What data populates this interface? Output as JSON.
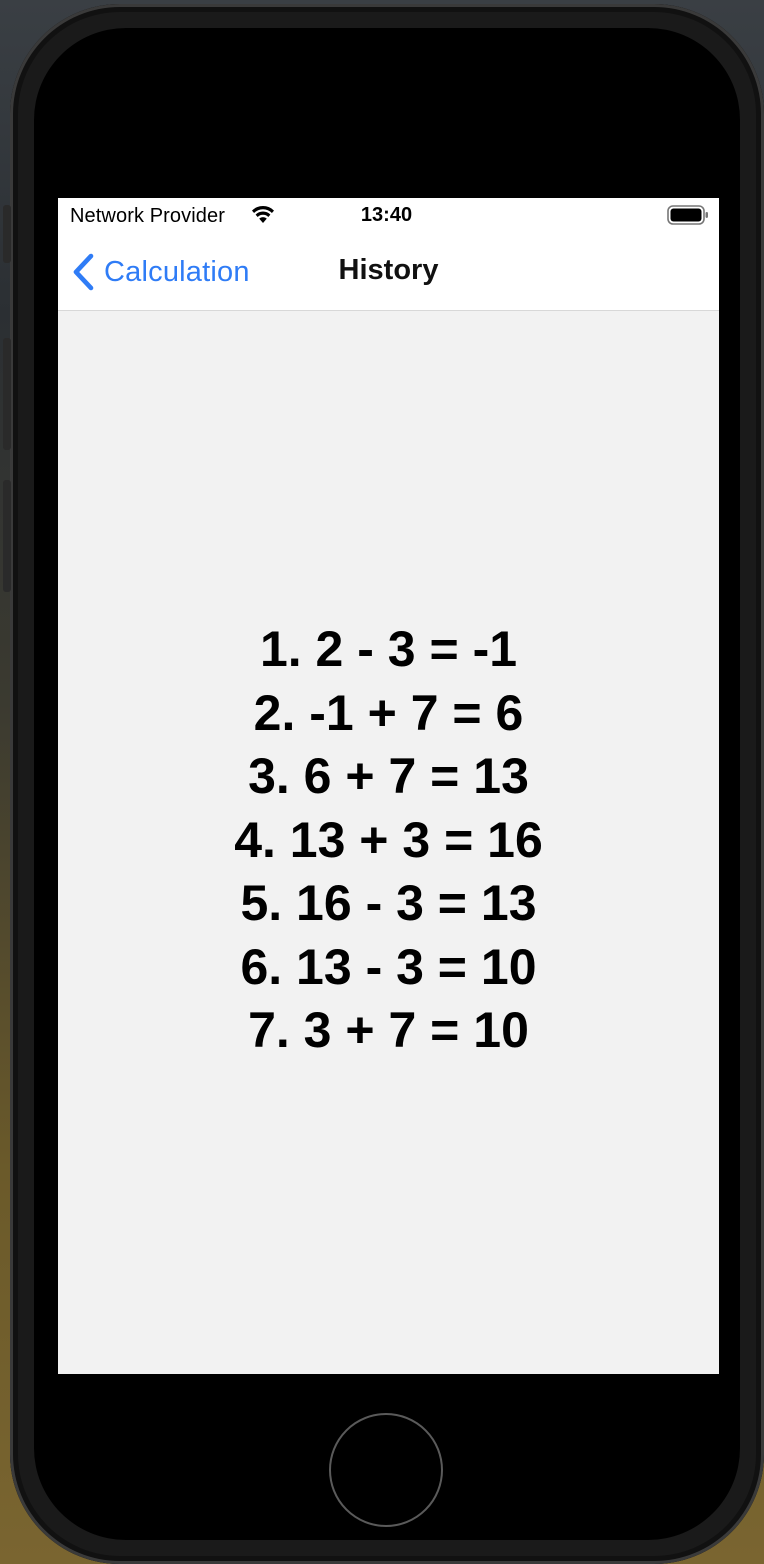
{
  "status_bar": {
    "carrier": "Network Provider",
    "time": "13:40",
    "wifi_icon": "wifi-icon",
    "battery_icon": "battery-full-icon"
  },
  "nav_bar": {
    "back_label": "Calculation",
    "back_icon": "chevron-left-icon",
    "title": "History"
  },
  "history": [
    "1. 2 - 3 = -1",
    "2. -1 + 7 = 6",
    "3. 6 + 7 = 13",
    "4. 13 + 3 = 16",
    "5. 16 - 3 = 13",
    "6. 13 - 3 = 10",
    "7. 3 + 7 = 10"
  ],
  "colors": {
    "accent": "#2f7cf6",
    "background": "#f2f2f2",
    "bar": "#ffffff"
  }
}
